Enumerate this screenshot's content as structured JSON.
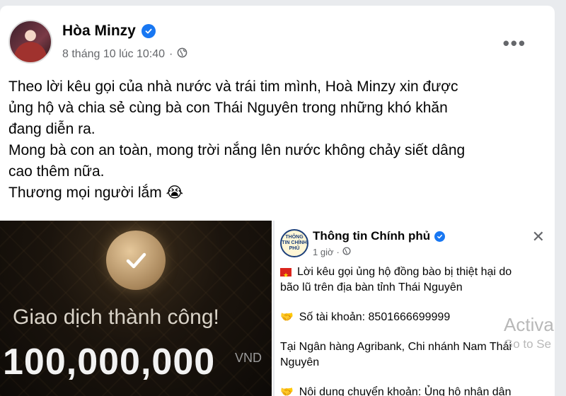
{
  "post": {
    "author": "Hòa Minzy",
    "timestamp": "8 tháng 10 lúc 10:40",
    "privacy_dot": "·",
    "more_label": "•••",
    "text_lines": [
      "Theo lời kêu gọi của nhà nước và trái tim mình, Hoà Minzy xin được",
      "ủng hộ và chia sẻ cùng bà con Thái Nguyên trong những khó khăn",
      "đang diễn ra.",
      "Mong bà con an toàn, mong trời nắng lên nước không chảy siết dâng",
      "cao thêm nữa.",
      "Thương mọi người lắm 😭"
    ]
  },
  "transfer_image": {
    "success_text": "Giao dịch thành công!",
    "amount": "100,000,000",
    "currency": "VND"
  },
  "gov_post": {
    "page_name": "Thông tin Chính phủ",
    "logo_text": "THÔNG TIN CHÍNH PHỦ",
    "time": "1 giờ",
    "dot": "·",
    "close_label": "✕",
    "line1": "Lời kêu gọi ủng hộ đồng bào bị thiệt hại do",
    "line2": "bão lũ trên địa bàn tỉnh Thái Nguyên",
    "account_line": "Số tài khoản: 8501666699999",
    "bank_line1": "Tại Ngân hàng Agribank, Chi nhánh Nam Thái",
    "bank_line2": "Nguyên",
    "content_line": "Nội dung chuyển khoản: Ủng hộ nhân dân"
  },
  "watermark": {
    "line1": "Activa",
    "line2": "Go to Se"
  },
  "colors": {
    "verified": "#1877f2",
    "text_primary": "#050505",
    "text_secondary": "#65676b"
  }
}
